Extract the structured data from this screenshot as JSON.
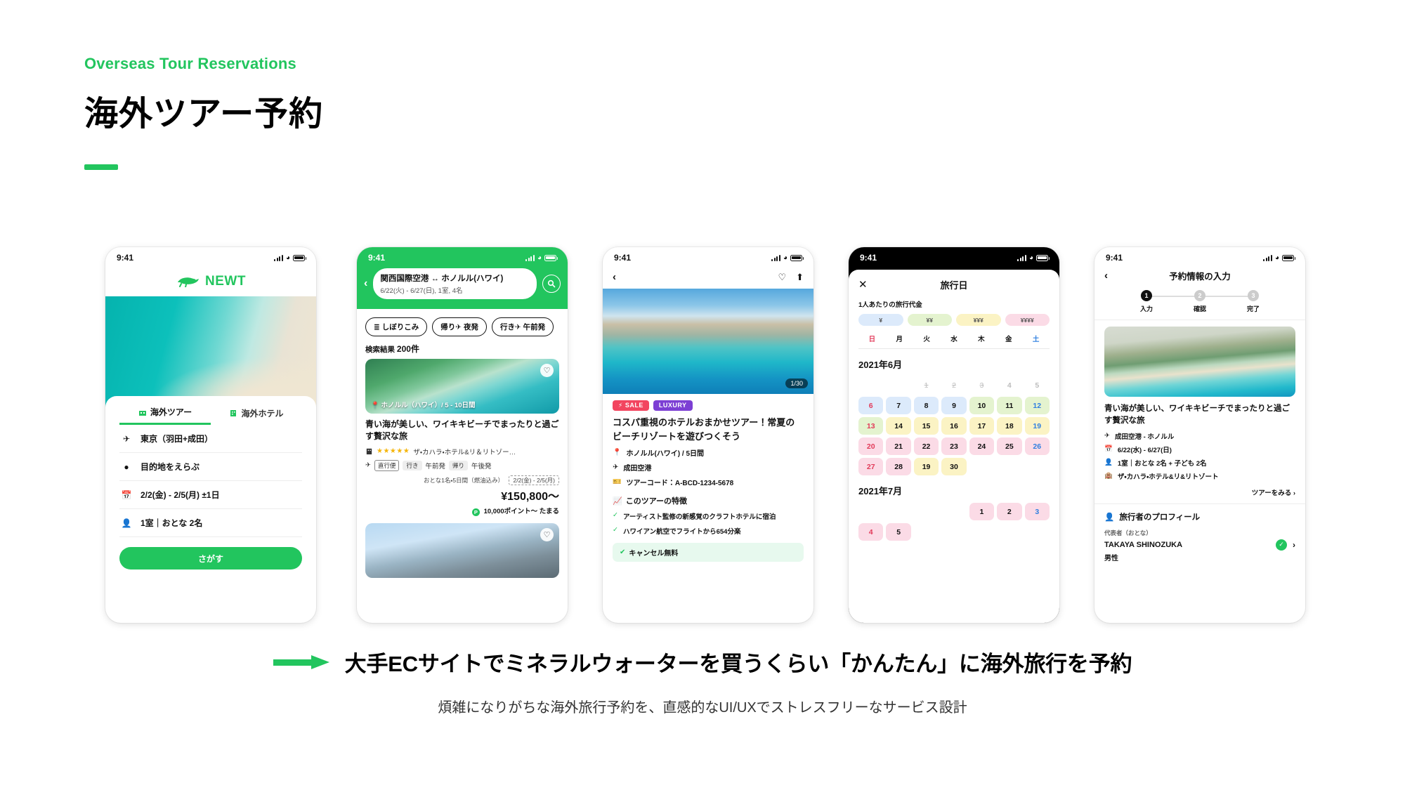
{
  "header": {
    "eyebrow": "Overseas Tour Reservations",
    "title": "海外ツアー予約"
  },
  "footer": {
    "headline": "大手ECサイトでミネラルウォーターを買うくらい「かんたん」に海外旅行を予約",
    "subline": "煩雑になりがちな海外旅行予約を、直感的なUI/UXでストレスフリーなサービス設計"
  },
  "colors": {
    "brand_green": "#22c55e",
    "sale_red": "#f2455f",
    "luxury_purple": "#7c3fd4",
    "sunday_red": "#e23b5a",
    "saturday_blue": "#2f7fe0"
  },
  "phones": [
    {
      "id": "home-search",
      "status_time": "9:41",
      "logo_text": "NEWT",
      "tabs": [
        {
          "label": "海外ツアー",
          "active": true
        },
        {
          "label": "海外ホテル",
          "active": false
        }
      ],
      "fields": [
        {
          "icon": "airplane-icon",
          "value": "東京（羽田+成田）"
        },
        {
          "icon": "pin-icon",
          "value": "目的地をえらぶ"
        },
        {
          "icon": "calendar-icon",
          "value": "2/2(金) - 2/5(月) ±1日"
        },
        {
          "icon": "person-icon",
          "value": "1室｜おとな 2名"
        }
      ],
      "submit_label": "さがす"
    },
    {
      "id": "search-results",
      "status_time": "9:41",
      "search_route": "関西国際空港 ↔ ホノルル(ハワイ)",
      "search_detail": "6/22(火) - 6/27(日), 1室, 4名",
      "chips": [
        "しぼりこみ",
        "帰り✈ 夜発",
        "行き✈ 午前発"
      ],
      "result_label": "検索結果",
      "result_count": "200件",
      "cards": [
        {
          "location": "ホノルル（ハワイ）/ 5 - 10日間",
          "title": "青い海が美しい、ワイキキビーチでまったりと過ごす贅沢な旅",
          "stars": "★★★★★",
          "hotel": "ザ・カハラ・ホテル&リ＆リトゾー…",
          "flight_tags": [
            "直行便",
            "行き",
            "午前発",
            "帰り",
            "午後発"
          ],
          "meta": "おとな1名・5日間（燃油込み）",
          "meta_date": "2/2(金) - 2/5(月)",
          "price": "¥150,800〜",
          "points": "10,000ポイント〜 たまる"
        },
        {
          "location": "",
          "title": "",
          "stars": "",
          "hotel": "",
          "flight_tags": [],
          "meta": "",
          "meta_date": "",
          "price": "",
          "points": ""
        }
      ]
    },
    {
      "id": "tour-detail",
      "status_time": "9:41",
      "photo_count": "1/30",
      "badges": [
        "SALE",
        "LUXURY"
      ],
      "title": "コスパ重視のホテルおまかせツアー！常夏のビーチリゾートを遊びつくそう",
      "info": [
        {
          "icon": "pin-icon",
          "value": "ホノルル(ハワイ) / 5日間"
        },
        {
          "icon": "airplane-icon",
          "value": "成田空港"
        },
        {
          "icon": "ticket-icon",
          "value": "ツアーコード：A-BCD-1234-5678"
        }
      ],
      "feature_title": "このツアーの特徴",
      "features": [
        "アーティスト監修の新感覚のクラフトホテルに宿泊",
        "ハワイアン航空でフライトから654分楽"
      ],
      "cancel_label": "キャンセル無料"
    },
    {
      "id": "travel-date-calendar",
      "status_time": "9:41",
      "sheet_title": "旅行日",
      "price_label": "1人あたりの旅行代金",
      "tiers": [
        "¥",
        "¥¥",
        "¥¥¥",
        "¥¥¥¥"
      ],
      "weekdays": [
        "日",
        "月",
        "火",
        "水",
        "木",
        "金",
        "土"
      ],
      "months": [
        {
          "label": "2021年6月",
          "lead_blanks": 2,
          "days": [
            {
              "n": "1",
              "state": "disabled"
            },
            {
              "n": "2",
              "state": "disabled"
            },
            {
              "n": "3",
              "state": "disabled"
            },
            {
              "n": "4",
              "state": "plain"
            },
            {
              "n": "5",
              "state": "plain"
            },
            {
              "n": "6",
              "tier": "blue",
              "kind": "sun"
            },
            {
              "n": "7",
              "tier": "blue"
            },
            {
              "n": "8",
              "tier": "blue"
            },
            {
              "n": "9",
              "tier": "blue"
            },
            {
              "n": "10",
              "tier": "green"
            },
            {
              "n": "11",
              "tier": "green"
            },
            {
              "n": "12",
              "tier": "green",
              "kind": "sat"
            },
            {
              "n": "13",
              "tier": "green",
              "kind": "sun"
            },
            {
              "n": "14",
              "tier": "yellow"
            },
            {
              "n": "15",
              "tier": "yellow"
            },
            {
              "n": "16",
              "tier": "yellow"
            },
            {
              "n": "17",
              "tier": "yellow"
            },
            {
              "n": "18",
              "tier": "yellow"
            },
            {
              "n": "19",
              "tier": "yellow",
              "kind": "sat"
            },
            {
              "n": "20",
              "tier": "pink",
              "kind": "sun"
            },
            {
              "n": "21",
              "tier": "pink"
            },
            {
              "n": "22",
              "tier": "pink"
            },
            {
              "n": "23",
              "tier": "pink"
            },
            {
              "n": "24",
              "tier": "pink"
            },
            {
              "n": "25",
              "tier": "pink"
            },
            {
              "n": "26",
              "tier": "pink",
              "kind": "sat"
            },
            {
              "n": "27",
              "tier": "pink",
              "kind": "sun"
            },
            {
              "n": "28",
              "tier": "pink"
            },
            {
              "n": "19",
              "tier": "yellow"
            },
            {
              "n": "30",
              "tier": "yellow"
            }
          ]
        },
        {
          "label": "2021年7月",
          "lead_blanks": 4,
          "days": [
            {
              "n": "1",
              "tier": "pink"
            },
            {
              "n": "2",
              "tier": "pink"
            },
            {
              "n": "3",
              "tier": "pink",
              "kind": "sat"
            },
            {
              "n": "4",
              "tier": "pink",
              "kind": "sun"
            },
            {
              "n": "5",
              "tier": "pink"
            }
          ]
        }
      ]
    },
    {
      "id": "booking-form",
      "status_time": "9:41",
      "title": "予約情報の入力",
      "steps": [
        {
          "num": "1",
          "label": "入力",
          "active": true
        },
        {
          "num": "2",
          "label": "確認",
          "active": false
        },
        {
          "num": "3",
          "label": "完了",
          "active": false
        }
      ],
      "tour_title": "青い海が美しい、ワイキキビーチでまったりと過ごす贅沢な旅",
      "tour_info": [
        {
          "icon": "airplane-icon",
          "value": "成田空港 - ホノルル"
        },
        {
          "icon": "calendar-icon",
          "value": "6/22(水) - 6/27(日)"
        },
        {
          "icon": "person-icon",
          "value": "1室｜おとな 2名 + 子ども 2名"
        },
        {
          "icon": "hotel-icon",
          "value": "ザ・カハラ・ホテル&リ&リトゾート"
        }
      ],
      "tour_link": "ツアーをみる ›",
      "profile_section": "旅行者のプロフィール",
      "rep_label": "代表者（おとな）",
      "rep_name": "TAKAYA SHINOZUKA",
      "rep_gender": "男性"
    }
  ]
}
